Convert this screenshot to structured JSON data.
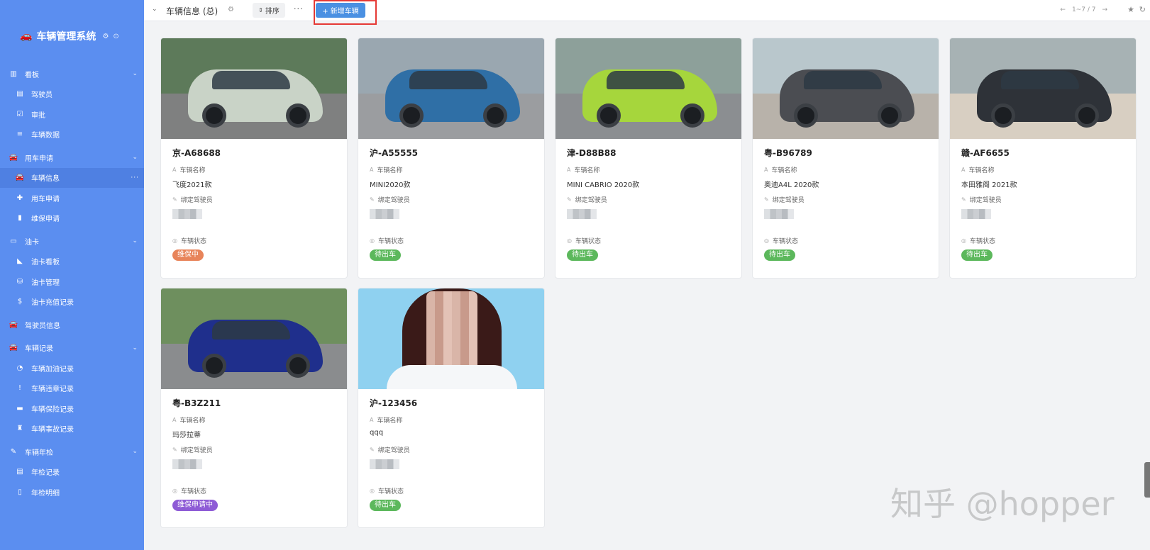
{
  "app": {
    "title": "车辆管理系统"
  },
  "sidebar": {
    "items": [
      {
        "type": "group",
        "label": "看板",
        "icon": "chart-icon",
        "expanded": true
      },
      {
        "type": "child",
        "label": "驾驶员",
        "icon": "id-card-icon"
      },
      {
        "type": "child",
        "label": "审批",
        "icon": "checkbox-icon"
      },
      {
        "type": "child",
        "label": "车辆数据",
        "icon": "list-icon"
      },
      {
        "type": "group",
        "label": "用车申请",
        "icon": "car-icon",
        "expanded": true
      },
      {
        "type": "child",
        "label": "车辆信息",
        "icon": "car-icon",
        "active": true
      },
      {
        "type": "child",
        "label": "用车申请",
        "icon": "plus-icon"
      },
      {
        "type": "child",
        "label": "维保申请",
        "icon": "file-icon"
      },
      {
        "type": "group",
        "label": "油卡",
        "icon": "card-icon",
        "expanded": true
      },
      {
        "type": "child",
        "label": "油卡看板",
        "icon": "area-chart-icon"
      },
      {
        "type": "child",
        "label": "油卡管理",
        "icon": "database-icon"
      },
      {
        "type": "child",
        "label": "油卡充值记录",
        "icon": "dollar-icon"
      },
      {
        "type": "group",
        "label": "驾驶员信息",
        "icon": "car-icon"
      },
      {
        "type": "group",
        "label": "车辆记录",
        "icon": "car-icon",
        "expanded": true
      },
      {
        "type": "child",
        "label": "车辆加油记录",
        "icon": "gauge-icon"
      },
      {
        "type": "child",
        "label": "车辆违章记录",
        "icon": "exclamation-icon"
      },
      {
        "type": "child",
        "label": "车辆保险记录",
        "icon": "briefcase-icon"
      },
      {
        "type": "child",
        "label": "车辆事故记录",
        "icon": "extinguisher-icon"
      },
      {
        "type": "group",
        "label": "车辆年检",
        "icon": "wrench-icon",
        "expanded": true
      },
      {
        "type": "child",
        "label": "年检记录",
        "icon": "list-alt-icon"
      },
      {
        "type": "child",
        "label": "年检明细",
        "icon": "book-icon"
      }
    ]
  },
  "toolbar": {
    "view_title": "车辆信息 (总)",
    "sort_label": "排序",
    "more_label": "···",
    "add_label": "+ 新增车辆",
    "pager_text": "1~7 / 7"
  },
  "field_labels": {
    "name": "车辆名称",
    "driver": "绑定驾驶员",
    "status": "车辆状态"
  },
  "status_colors": {
    "维保中": "#e8845a",
    "待出车": "#5cb85c",
    "维保申请中": "#8e5bd6"
  },
  "vehicles": [
    {
      "plate": "京-A68688",
      "name": "飞度2021款",
      "status": "维保中",
      "photo": "car-photo",
      "car_color": "#c9d3c7"
    },
    {
      "plate": "沪-A55555",
      "name": "MINI2020款",
      "status": "待出车",
      "photo": "car-photo",
      "car_color": "#2f6fa6"
    },
    {
      "plate": "津-D88B88",
      "name": "MINI CABRIO 2020款",
      "status": "待出车",
      "photo": "car-photo",
      "car_color": "#a6d63c"
    },
    {
      "plate": "粤-B96789",
      "name": "奥迪A4L 2020款",
      "status": "待出车",
      "photo": "car-photo",
      "car_color": "#4b4d52"
    },
    {
      "plate": "赣-AF6655",
      "name": "本田雅阁 2021款",
      "status": "待出车",
      "photo": "car-photo",
      "car_color": "#2e3238"
    },
    {
      "plate": "粤-B3Z211",
      "name": "玛莎拉蒂",
      "status": "维保申请中",
      "photo": "car-photo",
      "car_color": "#1f2f8c"
    },
    {
      "plate": "沪-123456",
      "name": "qqq",
      "status": "待出车",
      "photo": "portrait-photo",
      "car_color": ""
    }
  ],
  "watermark": "知乎 @hopper"
}
